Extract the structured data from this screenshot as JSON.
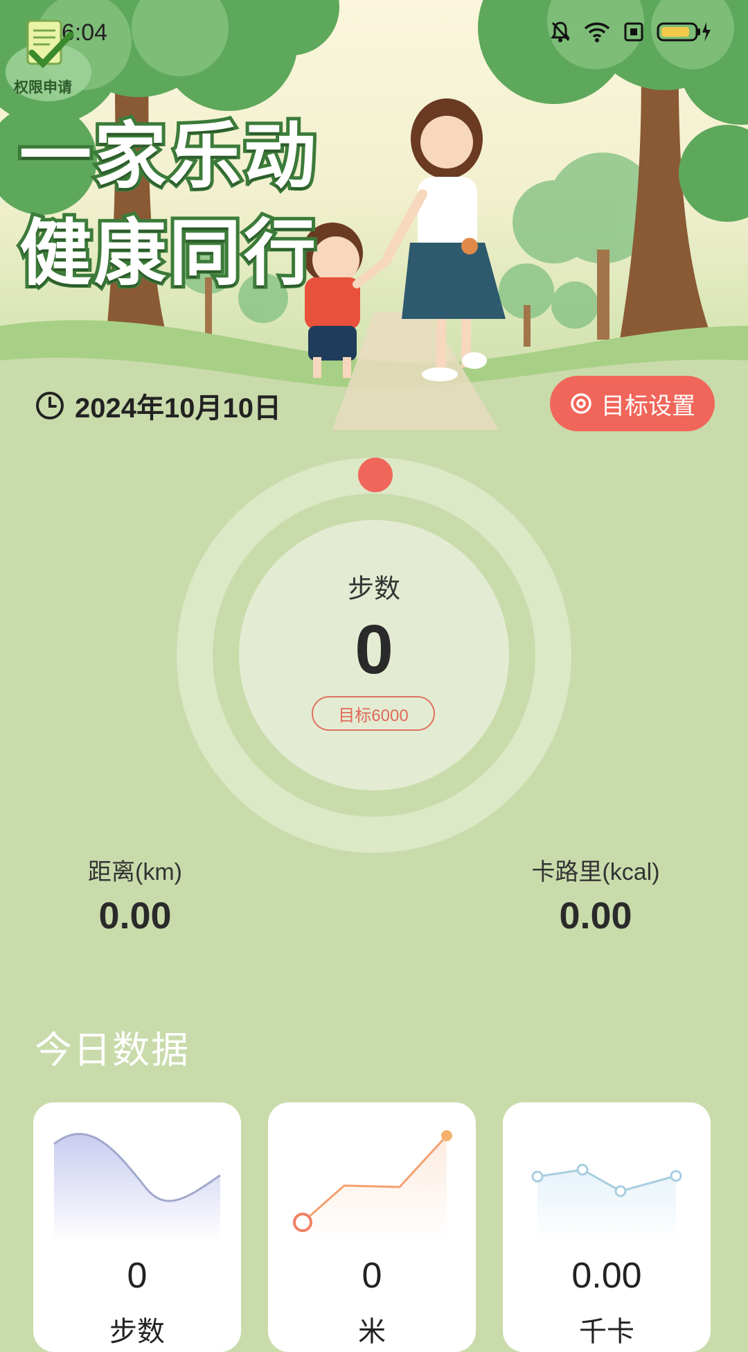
{
  "status_bar": {
    "time": "16:04",
    "icons": [
      "bell-off-icon",
      "wifi-icon",
      "sim-icon",
      "battery-charging-icon"
    ]
  },
  "permission_badge": {
    "label": "权限申请"
  },
  "hero": {
    "slogan_line1": "一家乐动",
    "slogan_line2": "健康同行",
    "date": "2024年10月10日",
    "goal_button_label": "目标设置"
  },
  "ring": {
    "label": "步数",
    "value": "0",
    "goal": "目标6000",
    "progress": 0
  },
  "stats": {
    "distance_label": "距离(km)",
    "distance_value": "0.00",
    "calorie_label": "卡路里(kcal)",
    "calorie_value": "0.00"
  },
  "today": {
    "title": "今日数据",
    "cards": [
      {
        "value": "0",
        "label": "步数"
      },
      {
        "value": "0",
        "label": "米"
      },
      {
        "value": "0.00",
        "label": "千卡"
      }
    ]
  },
  "colors": {
    "background": "#c9dbab",
    "accent": "#f1665a",
    "slogan_outline": "#3c7b3a"
  }
}
